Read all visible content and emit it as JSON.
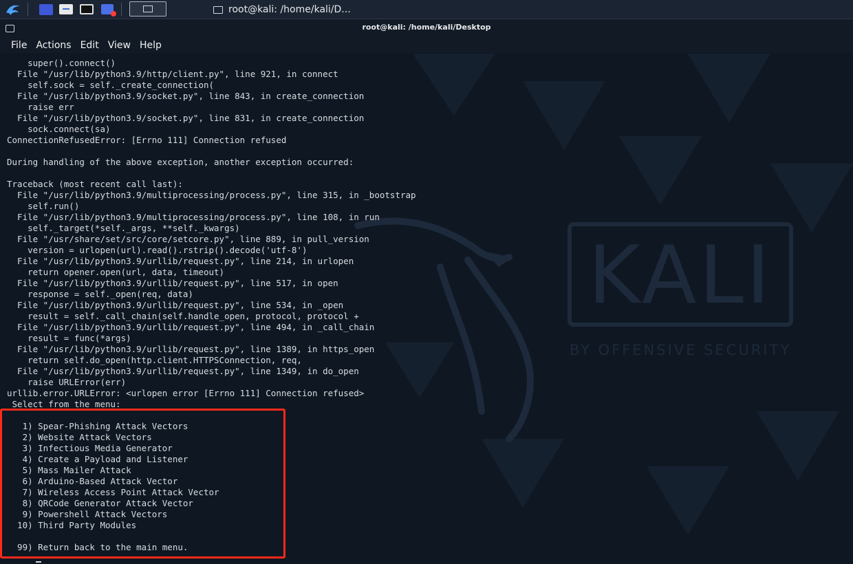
{
  "taskbar": {
    "task_title": "root@kali: /home/kali/D..."
  },
  "window": {
    "title": "root@kali: /home/kali/Desktop"
  },
  "menu": [
    "File",
    "Actions",
    "Edit",
    "View",
    "Help"
  ],
  "terminal_lines": [
    "    super().connect()",
    "  File \"/usr/lib/python3.9/http/client.py\", line 921, in connect",
    "    self.sock = self._create_connection(",
    "  File \"/usr/lib/python3.9/socket.py\", line 843, in create_connection",
    "    raise err",
    "  File \"/usr/lib/python3.9/socket.py\", line 831, in create_connection",
    "    sock.connect(sa)",
    "ConnectionRefusedError: [Errno 111] Connection refused",
    "",
    "During handling of the above exception, another exception occurred:",
    "",
    "Traceback (most recent call last):",
    "  File \"/usr/lib/python3.9/multiprocessing/process.py\", line 315, in _bootstrap",
    "    self.run()",
    "  File \"/usr/lib/python3.9/multiprocessing/process.py\", line 108, in run",
    "    self._target(*self._args, **self._kwargs)",
    "  File \"/usr/share/set/src/core/setcore.py\", line 889, in pull_version",
    "    version = urlopen(url).read().rstrip().decode('utf-8')",
    "  File \"/usr/lib/python3.9/urllib/request.py\", line 214, in urlopen",
    "    return opener.open(url, data, timeout)",
    "  File \"/usr/lib/python3.9/urllib/request.py\", line 517, in open",
    "    response = self._open(req, data)",
    "  File \"/usr/lib/python3.9/urllib/request.py\", line 534, in _open",
    "    result = self._call_chain(self.handle_open, protocol, protocol +",
    "  File \"/usr/lib/python3.9/urllib/request.py\", line 494, in _call_chain",
    "    result = func(*args)",
    "  File \"/usr/lib/python3.9/urllib/request.py\", line 1389, in https_open",
    "    return self.do_open(http.client.HTTPSConnection, req,",
    "  File \"/usr/lib/python3.9/urllib/request.py\", line 1349, in do_open",
    "    raise URLError(err)",
    "urllib.error.URLError: <urlopen error [Errno 111] Connection refused>",
    " Select from the menu:",
    "",
    "   1) Spear-Phishing Attack Vectors",
    "   2) Website Attack Vectors",
    "   3) Infectious Media Generator",
    "   4) Create a Payload and Listener",
    "   5) Mass Mailer Attack",
    "   6) Arduino-Based Attack Vector",
    "   7) Wireless Access Point Attack Vector",
    "   8) QRCode Generator Attack Vector",
    "   9) Powershell Attack Vectors",
    "  10) Third Party Modules",
    "",
    "  99) Return back to the main menu."
  ],
  "wallpaper": {
    "logo_text": "KALI",
    "tagline": "BY OFFENSIVE SECURITY"
  },
  "colors": {
    "highlight": "#ff2a1a",
    "terminal_bg": "#0f1722",
    "text": "#d9dde2"
  }
}
